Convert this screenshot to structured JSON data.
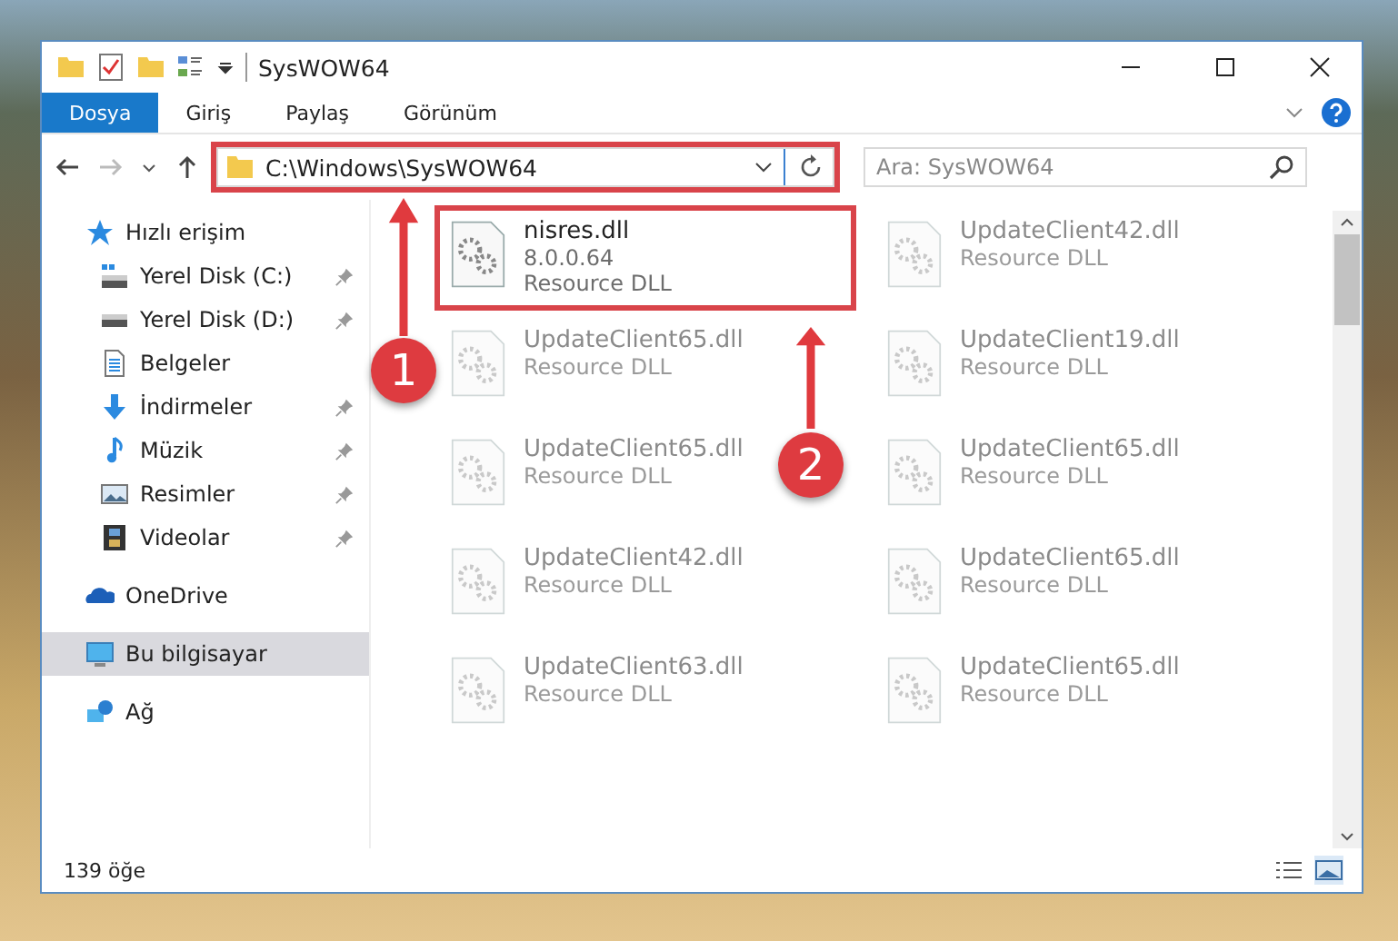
{
  "window": {
    "title": "SysWOW64"
  },
  "ribbon_tabs": [
    {
      "label": "Dosya",
      "selected": true
    },
    {
      "label": "Giriş",
      "selected": false
    },
    {
      "label": "Paylaş",
      "selected": false
    },
    {
      "label": "Görünüm",
      "selected": false
    }
  ],
  "address_bar": {
    "value": "C:\\Windows\\SysWOW64",
    "highlighted": true
  },
  "search": {
    "placeholder": "Ara: SysWOW64"
  },
  "sidebar": {
    "items": [
      {
        "label": "Hızlı erişim",
        "kind": "quick",
        "selected": false,
        "children": [
          {
            "label": "Yerel Disk (C:)",
            "kind": "drive-c",
            "pinned": true
          },
          {
            "label": "Yerel Disk (D:)",
            "kind": "drive",
            "pinned": true
          },
          {
            "label": "Belgeler",
            "kind": "docs",
            "pinned": false
          },
          {
            "label": "İndirmeler",
            "kind": "download",
            "pinned": true
          },
          {
            "label": "Müzik",
            "kind": "music",
            "pinned": true
          },
          {
            "label": "Resimler",
            "kind": "pictures",
            "pinned": true
          },
          {
            "label": "Videolar",
            "kind": "videos",
            "pinned": true
          }
        ]
      },
      {
        "label": "OneDrive",
        "kind": "cloud",
        "selected": false
      },
      {
        "label": "Bu bilgisayar",
        "kind": "pc",
        "selected": true
      },
      {
        "label": "Ağ",
        "kind": "network",
        "selected": false
      }
    ]
  },
  "files": [
    {
      "name": "nisres.dll",
      "version": "8.0.0.64",
      "type": "Resource DLL",
      "faded": false,
      "highlighted": true
    },
    {
      "name": "UpdateClient42.dll",
      "type": "Resource DLL",
      "faded": true,
      "highlighted": false
    },
    {
      "name": "UpdateClient65.dll",
      "type": "Resource DLL",
      "faded": true,
      "highlighted": false
    },
    {
      "name": "UpdateClient19.dll",
      "type": "Resource DLL",
      "faded": true,
      "highlighted": false
    },
    {
      "name": "UpdateClient65.dll",
      "type": "Resource DLL",
      "faded": true,
      "highlighted": false
    },
    {
      "name": "UpdateClient65.dll",
      "type": "Resource DLL",
      "faded": true,
      "highlighted": false
    },
    {
      "name": "UpdateClient42.dll",
      "type": "Resource DLL",
      "faded": true,
      "highlighted": false
    },
    {
      "name": "UpdateClient65.dll",
      "type": "Resource DLL",
      "faded": true,
      "highlighted": false
    },
    {
      "name": "UpdateClient63.dll",
      "type": "Resource DLL",
      "faded": true,
      "highlighted": false
    },
    {
      "name": "UpdateClient65.dll",
      "type": "Resource DLL",
      "faded": true,
      "highlighted": false
    }
  ],
  "annotations": [
    {
      "label": "1"
    },
    {
      "label": "2"
    }
  ],
  "status_bar": {
    "count": "139 öğe"
  }
}
